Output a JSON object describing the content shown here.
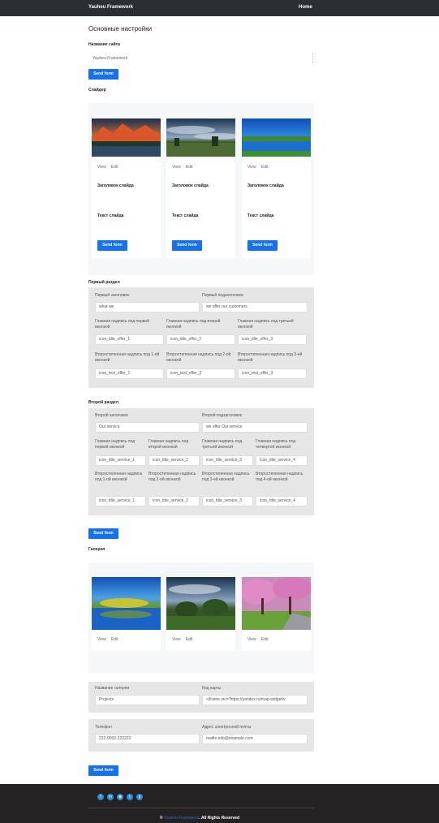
{
  "nav": {
    "brand": "Yauheu Framework",
    "home": "Home"
  },
  "page": {
    "title": "Основные настройки"
  },
  "site_name": {
    "label": "Название сайта",
    "value": "Yauheu Framework",
    "submit": "Send form"
  },
  "slider": {
    "label": "Слайдер",
    "cards": [
      {
        "image": "mountain-lake-sunset",
        "view": "View",
        "edit": "Edit",
        "title_label": "Заголовок слайда",
        "text_label": "Текст слайда",
        "submit": "Send form"
      },
      {
        "image": "cloudy-field-landscape",
        "view": "View",
        "edit": "Edit",
        "title_label": "Заголовок слайда",
        "text_label": "Текст слайда",
        "submit": "Send form"
      },
      {
        "image": "blue-lake-landscape",
        "view": "View",
        "edit": "Edit",
        "title_label": "Заголовок слайда",
        "text_label": "Текст слайда",
        "submit": "Send form"
      }
    ]
  },
  "section1": {
    "label": "Первый раздел",
    "title_label": "Первый заголовок",
    "title_value": "what we",
    "subtitle_label": "Первый подзаголовок",
    "subtitle_value": "we offer our customers",
    "main": [
      {
        "label": "Главная надпись под первой иконкой",
        "value": "icon_title_offer_1"
      },
      {
        "label": "Главная надпись под второй иконкой",
        "value": "icon_title_offer_2"
      },
      {
        "label": "Главная надпись под третьей иконкой",
        "value": "icon_title_offer_3"
      }
    ],
    "secondary": [
      {
        "label": "Второстепенная надпись под 1-ой иконкой",
        "value": "icon_text_offer_1"
      },
      {
        "label": "Второстепенная надпись под 2-ой иконкой",
        "value": "icon_text_offer_2"
      },
      {
        "label": "Второстепенная надпись под 3-ей иконкой",
        "value": "icon_text_offer_3"
      }
    ]
  },
  "section2": {
    "label": "Второй раздел",
    "title_label": "Второй заголовок",
    "title_value": "Our service",
    "subtitle_label": "Второй подзаголовок",
    "subtitle_value": "we offer Our service",
    "main": [
      {
        "label": "Главная надпись под первой иконкой",
        "value": "icon_title_service_1"
      },
      {
        "label": "Главная надпись под второй иконкой",
        "value": "icon_title_service_2"
      },
      {
        "label": "Главная надпись под третьей иконкой",
        "value": "icon_title_service_3"
      },
      {
        "label": "Главная надпись под четвертой иконкой",
        "value": "icon_title_service_4"
      }
    ],
    "secondary": [
      {
        "label": "Второстепенная надпись под 1-ой иконкой",
        "value": "icon_title_service_1"
      },
      {
        "label": "Второстепенная надпись под 2-ой иконкой",
        "value": "icon_title_service_2"
      },
      {
        "label": "Второстепенная надпись под 3-ей иконкой",
        "value": "icon_title_service_3"
      },
      {
        "label": "Второстепенная надпись под 4-ой иконкой",
        "value": "icon_title_service_4"
      }
    ],
    "submit": "Send form"
  },
  "gallery": {
    "label": "Галерея",
    "cards": [
      {
        "image": "lake-reflection",
        "view": "View",
        "edit": "Edit"
      },
      {
        "image": "sky-trees",
        "view": "View",
        "edit": "Edit"
      },
      {
        "image": "blossom-trees-path",
        "view": "View",
        "edit": "Edit"
      }
    ],
    "name_label": "Название галереи",
    "name_value": "Projects",
    "map_label": "Код карты",
    "map_value": "<iframe src=\"https://yandex.ru/map-widget/v",
    "phone_label": "Телефон",
    "phone_value": "222-0002-222222",
    "email_label": "Адрес электронной почты",
    "email_value": "mailto:info@example.com",
    "submit": "Send form"
  },
  "footer": {
    "social": [
      "facebook-icon",
      "linkedin-icon",
      "vk-icon",
      "twitter-icon",
      "pinterest-icon"
    ],
    "copyright_symbol": "©",
    "copyright_brand": "Yauheu Framework",
    "copyright_text": ". All Rights Reserved"
  }
}
